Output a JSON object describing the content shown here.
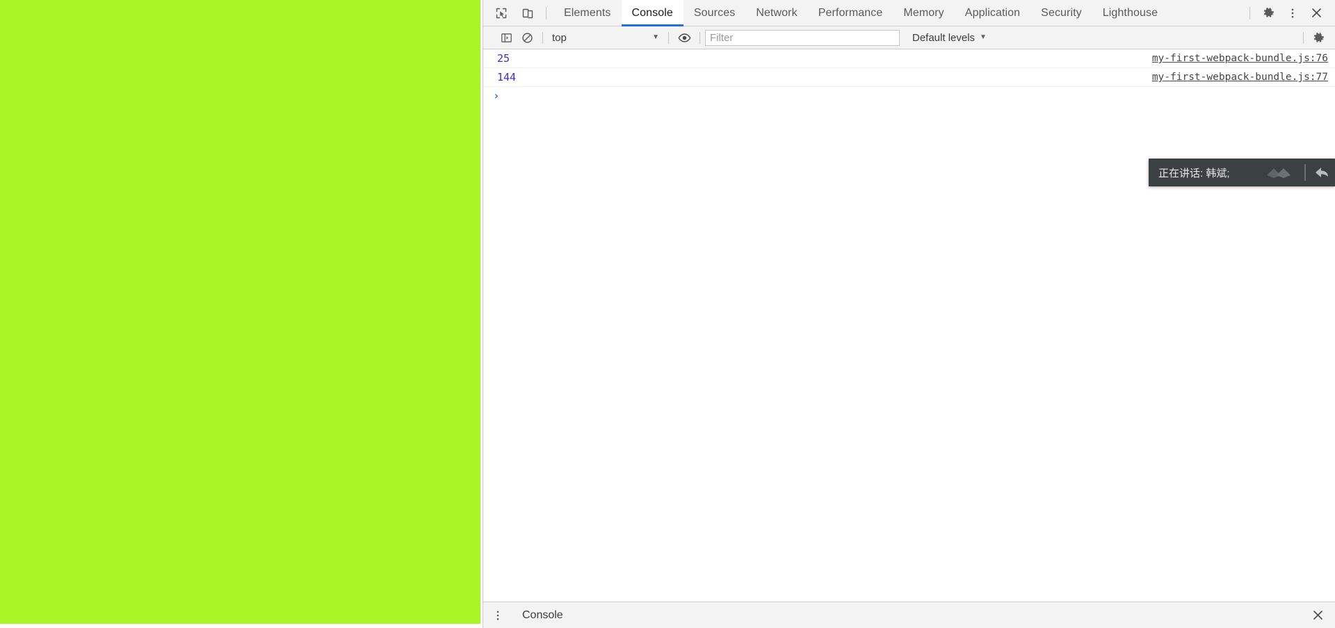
{
  "page": {
    "background_color": "#a8f424",
    "name": "page-content-area"
  },
  "devtools": {
    "tabstrip": {
      "inspect_icon": "inspect-element-icon",
      "device_icon": "device-toolbar-icon",
      "tabs": [
        {
          "label": "Elements",
          "active": false
        },
        {
          "label": "Console",
          "active": true
        },
        {
          "label": "Sources",
          "active": false
        },
        {
          "label": "Network",
          "active": false
        },
        {
          "label": "Performance",
          "active": false
        },
        {
          "label": "Memory",
          "active": false
        },
        {
          "label": "Application",
          "active": false
        },
        {
          "label": "Security",
          "active": false
        },
        {
          "label": "Lighthouse",
          "active": false
        }
      ],
      "settings_icon": "gear-icon",
      "more_icon": "kebab-menu-icon",
      "close_icon": "close-icon",
      "accent_color": "#1a73e8"
    },
    "console_toolbar": {
      "sidebar_toggle_icon": "console-sidebar-icon",
      "clear_icon": "clear-console-icon",
      "context": {
        "value": "top",
        "caret": "▼"
      },
      "eye_icon": "live-expression-icon",
      "filter": {
        "value": "",
        "placeholder": "Filter"
      },
      "levels": {
        "label": "Default levels",
        "caret": "▼"
      },
      "settings_icon": "console-settings-gear-icon"
    },
    "console_messages": [
      {
        "value": "25",
        "source": "my-first-webpack-bundle.js:76"
      },
      {
        "value": "144",
        "source": "my-first-webpack-bundle.js:77"
      }
    ],
    "prompt": {
      "caret": "›",
      "value": "",
      "placeholder": ""
    },
    "drawer": {
      "kebab_icon": "kebab-menu-icon",
      "tab_label": "Console",
      "close_icon": "close-drawer-icon"
    }
  },
  "speaking_overlay": {
    "label": "正在讲话: 韩斌;",
    "background_color": "#3b4043",
    "mute_icon": "speaker-mute-icon",
    "back_icon": "undo-arrow-icon"
  }
}
